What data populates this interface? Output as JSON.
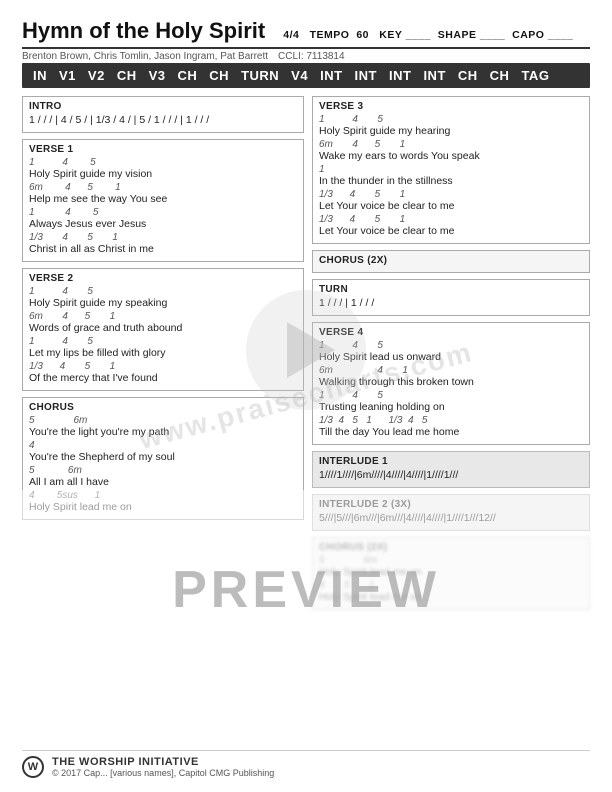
{
  "title": "Hymn of the Holy Spirit",
  "time_signature": "4/4",
  "tempo_label": "TEMPO",
  "tempo_value": "60",
  "key_label": "KEY",
  "shape_label": "SHAPE",
  "capo_label": "CAPO",
  "authors": "Brenton Brown, Chris Tomlin, Jason Ingram, Pat Barrett",
  "ccli": "CCLI: 7113814",
  "nav": {
    "items": [
      {
        "label": "IN",
        "highlight": false
      },
      {
        "label": "V1",
        "highlight": false
      },
      {
        "label": "V2",
        "highlight": false
      },
      {
        "label": "CH",
        "highlight": false
      },
      {
        "label": "V3",
        "highlight": false
      },
      {
        "label": "CH",
        "highlight": false
      },
      {
        "label": "CH",
        "highlight": false
      },
      {
        "label": "TURN",
        "highlight": false
      },
      {
        "label": "V4",
        "highlight": false
      },
      {
        "label": "INT",
        "highlight": false
      },
      {
        "label": "INT",
        "highlight": false
      },
      {
        "label": "INT",
        "highlight": false
      },
      {
        "label": "INT",
        "highlight": false
      },
      {
        "label": "CH",
        "highlight": false
      },
      {
        "label": "CH",
        "highlight": false
      },
      {
        "label": "TAG",
        "highlight": false
      }
    ]
  },
  "intro": {
    "label": "INTRO",
    "line1": "1 / / / | 4 / 5 / | 1/3 / 4 / | 5 / 1 / / / | 1 / / /"
  },
  "verse1": {
    "label": "VERSE 1",
    "lines": [
      {
        "type": "chord",
        "text": "1          4        5"
      },
      {
        "type": "lyric",
        "text": "Holy Spirit guide my vision"
      },
      {
        "type": "chord",
        "text": "6m        4       5        1"
      },
      {
        "type": "lyric",
        "text": "Help me see the way You see"
      },
      {
        "type": "chord",
        "text": "1           4       5"
      },
      {
        "type": "lyric",
        "text": "Always Jesus ever Jesus"
      },
      {
        "type": "chord",
        "text": "1/3       4       5       1"
      },
      {
        "type": "lyric",
        "text": "Christ in all as Christ in me"
      }
    ]
  },
  "verse2": {
    "label": "VERSE 2",
    "lines": [
      {
        "type": "chord",
        "text": "1          4       5"
      },
      {
        "type": "lyric",
        "text": "Holy Spirit guide my speaking"
      },
      {
        "type": "chord",
        "text": "6m       4       5       1"
      },
      {
        "type": "lyric",
        "text": "Words of grace and truth abound"
      },
      {
        "type": "chord",
        "text": "1          4       5"
      },
      {
        "type": "lyric",
        "text": "Let my lips be filled with glory"
      },
      {
        "type": "chord",
        "text": "1/3      4       5       1"
      },
      {
        "type": "lyric",
        "text": "Of the mercy that I've found"
      }
    ]
  },
  "chorus": {
    "label": "CHORUS",
    "lines": [
      {
        "type": "chord",
        "text": "5               6m"
      },
      {
        "type": "lyric",
        "text": "You're the light you're my path"
      },
      {
        "type": "chord",
        "text": "4"
      },
      {
        "type": "lyric",
        "text": "You're the Shepherd of my soul"
      },
      {
        "type": "chord",
        "text": "5            6m"
      },
      {
        "type": "lyric",
        "text": "All I am all I have"
      },
      {
        "type": "chord",
        "text": "4         5sus       1"
      },
      {
        "type": "lyric",
        "text": "Holy Spirit lead me on"
      }
    ]
  },
  "verse3": {
    "label": "VERSE 3",
    "lines": [
      {
        "type": "chord",
        "text": "1          4       5"
      },
      {
        "type": "lyric",
        "text": "Holy Spirit guide my hearing"
      },
      {
        "type": "chord",
        "text": "6m       4       5       1"
      },
      {
        "type": "lyric",
        "text": "Wake my ears to words You speak"
      },
      {
        "type": "chord",
        "text": "1"
      },
      {
        "type": "lyric",
        "text": "In the thunder in the stillness"
      },
      {
        "type": "chord",
        "text": "1/3      4       5       1"
      },
      {
        "type": "lyric",
        "text": "Let Your voice be clear to me"
      },
      {
        "type": "chord",
        "text": "1/3      4       5       1"
      },
      {
        "type": "lyric",
        "text": "Let Your voice be clear to me"
      }
    ]
  },
  "chorus2x": {
    "label": "CHORUS (2X)",
    "lines": []
  },
  "turn": {
    "label": "TURN",
    "lines": [
      {
        "type": "chord",
        "text": ""
      },
      {
        "type": "lyric",
        "text": "1 / / / | 1 / / /"
      }
    ]
  },
  "verse4": {
    "label": "VERSE 4",
    "lines": [
      {
        "type": "chord",
        "text": "1          4       5"
      },
      {
        "type": "lyric",
        "text": "Holy Spirit lead us onward"
      },
      {
        "type": "chord",
        "text": "6m                4       1"
      },
      {
        "type": "lyric",
        "text": "Walking through this broken town"
      },
      {
        "type": "chord",
        "text": "1          4       5"
      },
      {
        "type": "lyric",
        "text": "Trusting leaning holding on"
      },
      {
        "type": "chord",
        "text": "1/3      4       5       1       1/3      4      5"
      },
      {
        "type": "lyric",
        "text": "Till the day You lead me home"
      }
    ]
  },
  "interlude1": {
    "label": "INTERLUDE 1",
    "lines": [
      {
        "type": "lyric",
        "text": "1////1////|6m////|4////|4////|1////1///"
      }
    ]
  },
  "interlude2": {
    "label": "INTERLUDE 2 (3X)",
    "lines": [
      {
        "type": "lyric",
        "text": "5///|5///|6m///|6m///|4////|4////|1////1///12//"
      }
    ]
  },
  "chorus2x_bottom": {
    "label": "CHORUS (2X)",
    "lines": [
      {
        "type": "chord",
        "text": "5             6m"
      },
      {
        "type": "lyric",
        "text": "Holy Spirit lead me on"
      },
      {
        "type": "chord",
        "text": "4       5       1"
      },
      {
        "type": "lyric",
        "text": "Holy Spirit lead me on"
      }
    ]
  },
  "footer": {
    "logo_text": "W",
    "brand": "THE WORSHIP INITIATIVE",
    "copyright": "© 2017 Cap... [various names], Capitol CMG Publishing"
  },
  "watermark": {
    "site": "www.praisecharts.com",
    "preview": "PREVIEW"
  }
}
